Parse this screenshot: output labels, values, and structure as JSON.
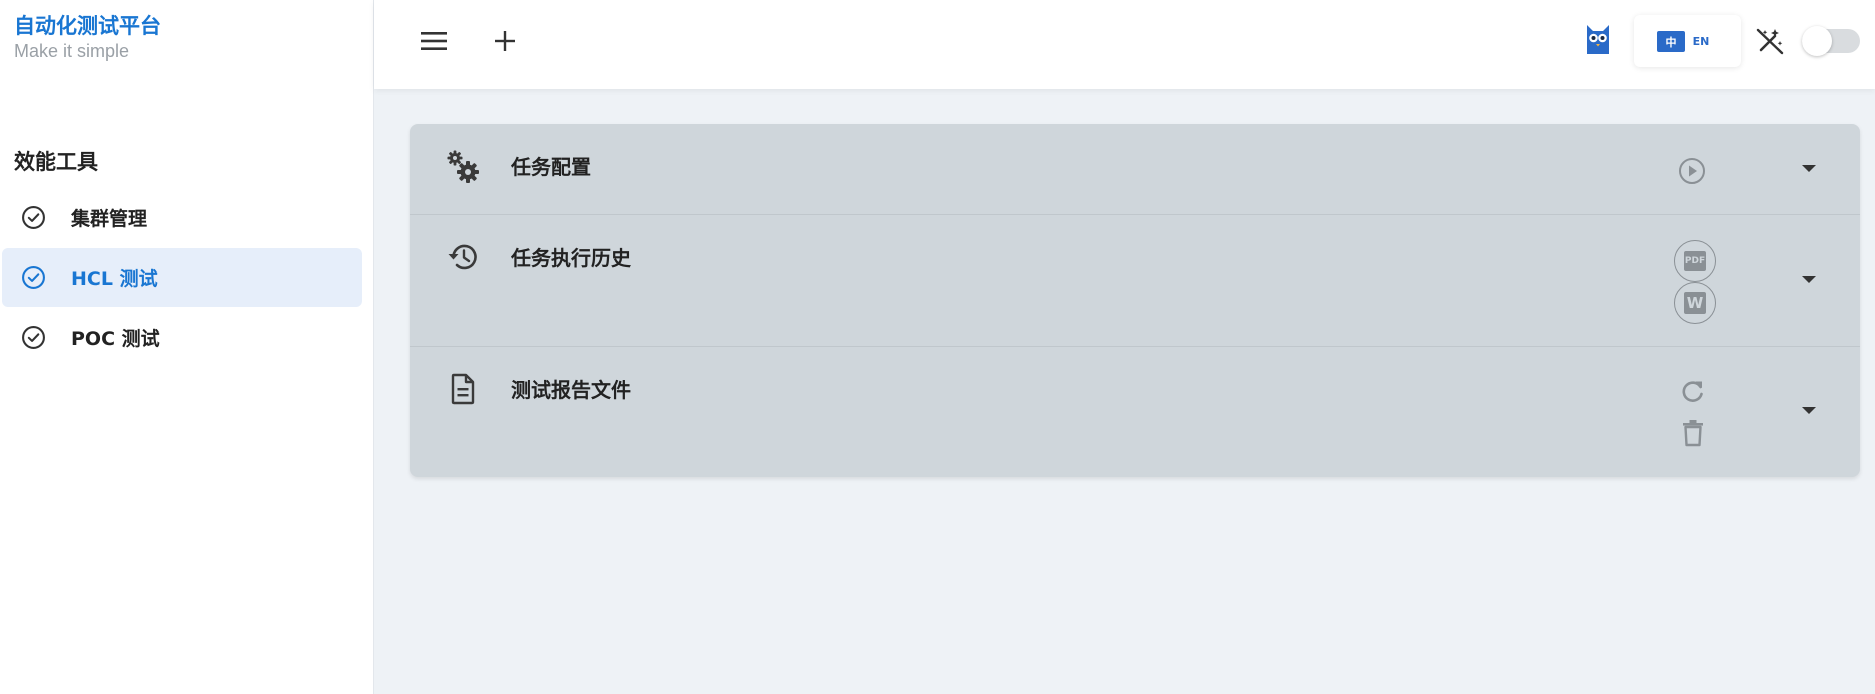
{
  "brand": {
    "title": "自动化测试平台",
    "subtitle": "Make it simple"
  },
  "sidebar": {
    "section_title": "效能工具",
    "items": [
      {
        "label": "集群管理",
        "icon": "check-circle-icon",
        "active": false
      },
      {
        "label": "HCL 测试",
        "icon": "check-circle-icon",
        "active": true
      },
      {
        "label": "POC 测试",
        "icon": "check-circle-icon",
        "active": false
      }
    ]
  },
  "topbar": {
    "menu_icon": "menu-icon",
    "add_icon": "plus-icon",
    "logo_icon": "owl-logo-icon",
    "language": {
      "zh": "中",
      "en": "EN",
      "selected": "zh"
    },
    "theme_icon": "magic-wand-off-icon",
    "theme_toggle_on": false
  },
  "panels": [
    {
      "title": "任务配置",
      "icon": "gears-icon",
      "actions": [
        "play-circle-icon"
      ]
    },
    {
      "title": "任务执行历史",
      "icon": "history-icon",
      "actions": [
        "pdf-icon",
        "word-icon"
      ],
      "pdf_label": "PDF",
      "word_label": "W"
    },
    {
      "title": "测试报告文件",
      "icon": "document-icon",
      "actions": [
        "refresh-icon",
        "trash-icon"
      ]
    }
  ],
  "colors": {
    "accent": "#1976d2",
    "panel_bg": "#cfd6db",
    "page_bg": "#eef2f6",
    "active_bg": "#e6eefa"
  }
}
